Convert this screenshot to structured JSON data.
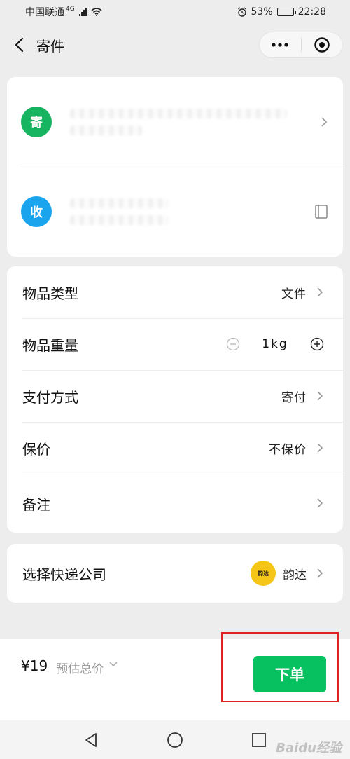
{
  "status_bar": {
    "carrier": "中国联通",
    "network": "4G",
    "battery": "53%",
    "battery_level": 0.53,
    "time": "22:28"
  },
  "nav": {
    "title": "寄件"
  },
  "addresses": {
    "sender_badge": "寄",
    "receiver_badge": "收"
  },
  "options": {
    "item_type": {
      "label": "物品类型",
      "value": "文件"
    },
    "weight": {
      "label": "物品重量",
      "value": "1kg"
    },
    "payment": {
      "label": "支付方式",
      "value": "寄付"
    },
    "insurance": {
      "label": "保价",
      "value": "不保价"
    },
    "remark": {
      "label": "备注"
    }
  },
  "courier": {
    "label": "选择快递公司",
    "logo_text": "韵达",
    "name": "韵达"
  },
  "footer": {
    "price": "¥19",
    "price_label": "预估总价",
    "order_button": "下单"
  },
  "watermark": "Baidu经验",
  "colors": {
    "primary_green": "#07c160",
    "sender_badge": "#16b461",
    "receiver_badge": "#1aa4ed",
    "courier_logo": "#f5c518",
    "highlight": "#dd2222"
  }
}
